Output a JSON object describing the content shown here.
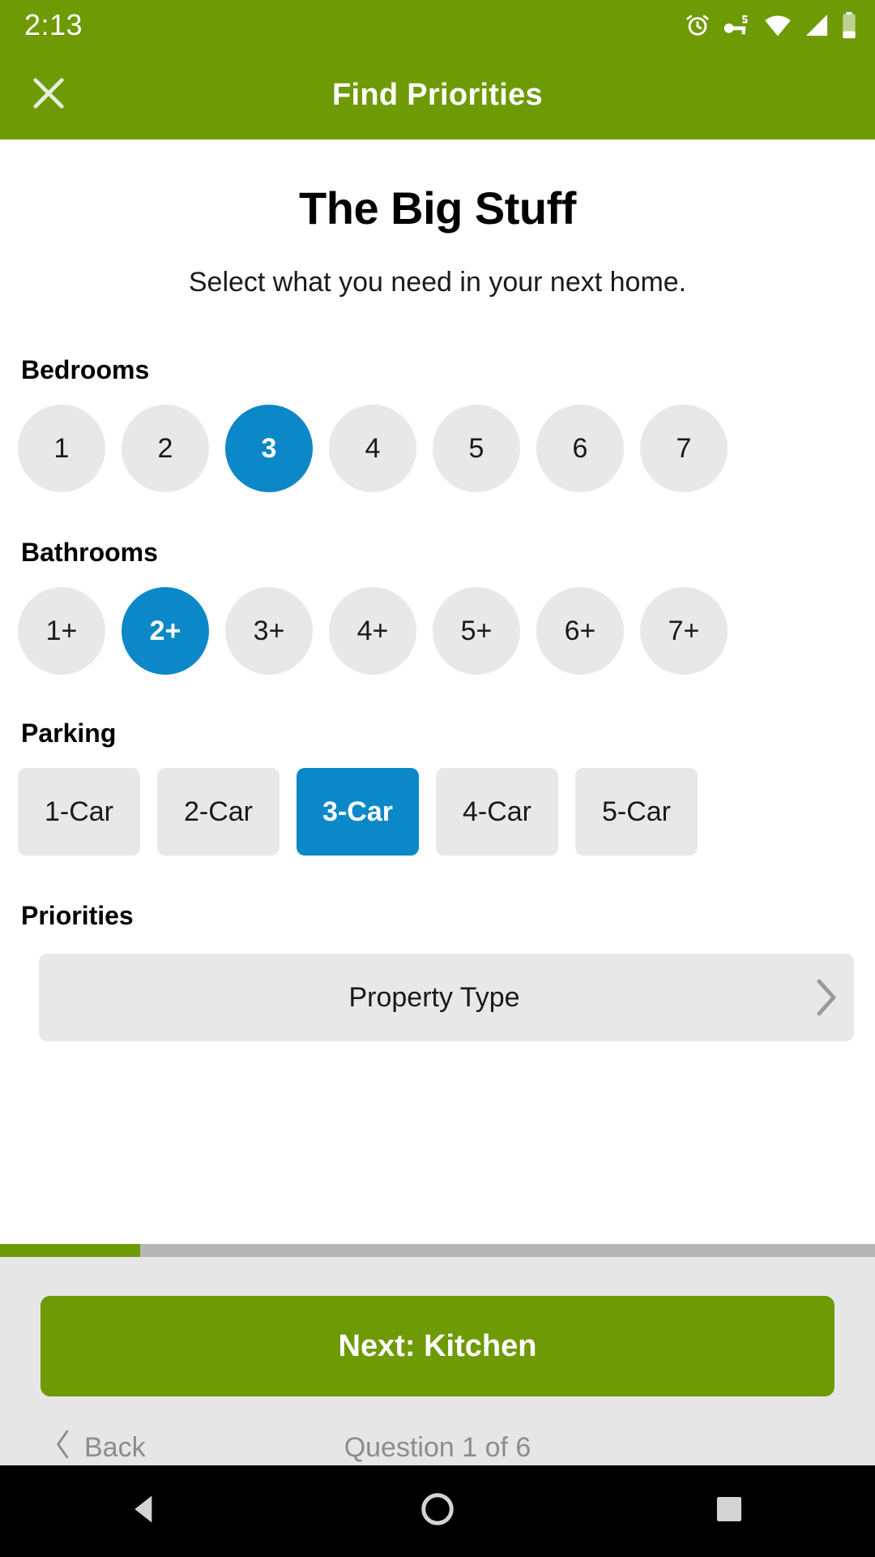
{
  "status_bar": {
    "time": "2:13",
    "icons": [
      "alarm-clock-icon",
      "vpn-key-icon",
      "wifi-icon",
      "cell-signal-icon",
      "battery-icon"
    ],
    "background_color": "#6E9A06"
  },
  "app_bar": {
    "close_icon": "close-icon",
    "title": "Find Priorities"
  },
  "main": {
    "title": "The Big Stuff",
    "subtitle": "Select what you need in your next home.",
    "accent_selected_color": "#0c88c8",
    "chip_unselected_color": "#e8e8e8",
    "sections": [
      {
        "label": "Bedrooms",
        "shape": "circle",
        "options": [
          "1",
          "2",
          "3",
          "4",
          "5",
          "6",
          "7"
        ],
        "selected": "3"
      },
      {
        "label": "Bathrooms",
        "shape": "circle",
        "options": [
          "1+",
          "2+",
          "3+",
          "4+",
          "5+",
          "6+",
          "7+"
        ],
        "selected": "2+"
      },
      {
        "label": "Parking",
        "shape": "rect",
        "options": [
          "1-Car",
          "2-Car",
          "3-Car",
          "4-Car",
          "5-Car"
        ],
        "selected": "3-Car"
      }
    ],
    "priorities": {
      "label": "Priorities",
      "rows": [
        {
          "label": "Property Type",
          "chevron": "chevron-right-icon"
        }
      ]
    }
  },
  "progress": {
    "percent": 16,
    "fill_color": "#6E9A06",
    "track_color": "#b5b5b5"
  },
  "bottom": {
    "next_label": "Next: Kitchen",
    "next_color": "#6E9A06",
    "back_label": "Back",
    "back_icon": "chevron-left-icon",
    "question_counter": "Question 1 of 6"
  },
  "nav_bar": {
    "back": "triangle-back-icon",
    "home": "circle-home-icon",
    "recents": "square-recents-icon"
  }
}
